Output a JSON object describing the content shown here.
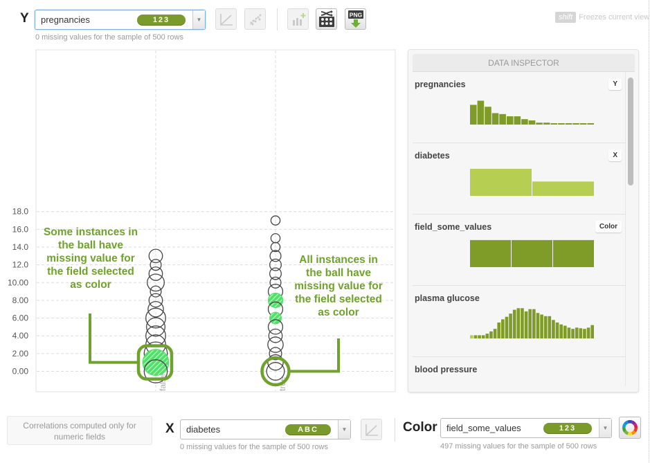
{
  "y_axis": {
    "letter": "Y",
    "field": "pregnancies",
    "type_badge": "123",
    "missing_note": "0 missing values for the sample of 500 rows"
  },
  "toolbar": {
    "buttons": [
      {
        "name": "regression-line-button",
        "icon": "line-chart-icon",
        "enabled": false
      },
      {
        "name": "scatter-trend-button",
        "icon": "scatter-icon",
        "enabled": false
      },
      {
        "name": "add-histogram-button",
        "icon": "bar-add-icon",
        "enabled": false
      },
      {
        "name": "shuffle-sample-button",
        "icon": "shuffle-grid-icon",
        "enabled": true
      },
      {
        "name": "export-png-button",
        "icon": "png-download-icon",
        "enabled": true,
        "label": "PNG"
      }
    ],
    "shift_key": "shift",
    "shift_hint": "Freezes current view"
  },
  "chart_data": {
    "type": "scatter",
    "title": "",
    "xlabel": "diabetes",
    "ylabel": "pregnancies",
    "ylim": [
      -1,
      18
    ],
    "y_ticks": [
      "18.0",
      "16.0",
      "14.0",
      "12.0",
      "10.00",
      "8.00",
      "6.00",
      "4.00",
      "2.00",
      "0.00"
    ],
    "y_tick_values": [
      18,
      16,
      14,
      12,
      10,
      8,
      6,
      4,
      2,
      0
    ],
    "categories": [
      "false",
      "true"
    ],
    "grid": true,
    "series": [
      {
        "name": "false",
        "points": [
          {
            "y": 13,
            "size": 2,
            "missing_color": "none"
          },
          {
            "y": 12,
            "size": 1,
            "missing_color": "none"
          },
          {
            "y": 11,
            "size": 2,
            "missing_color": "none"
          },
          {
            "y": 10,
            "size": 4,
            "missing_color": "none"
          },
          {
            "y": 9,
            "size": 1,
            "missing_color": "none"
          },
          {
            "y": 8,
            "size": 2,
            "missing_color": "none"
          },
          {
            "y": 7,
            "size": 3,
            "missing_color": "none"
          },
          {
            "y": 6,
            "size": 6,
            "missing_color": "none"
          },
          {
            "y": 5,
            "size": 5,
            "missing_color": "none"
          },
          {
            "y": 4,
            "size": 6,
            "missing_color": "none"
          },
          {
            "y": 3,
            "size": 6,
            "missing_color": "none"
          },
          {
            "y": 2,
            "size": 9,
            "missing_color": "none"
          },
          {
            "y": 1,
            "size": 12,
            "missing_color": "some"
          },
          {
            "y": 0,
            "size": 9,
            "missing_color": "none"
          }
        ]
      },
      {
        "name": "true",
        "points": [
          {
            "y": 17,
            "size": 0.5,
            "missing_color": "none"
          },
          {
            "y": 15,
            "size": 0.5,
            "missing_color": "none"
          },
          {
            "y": 14,
            "size": 0.5,
            "missing_color": "none"
          },
          {
            "y": 13,
            "size": 1,
            "missing_color": "none"
          },
          {
            "y": 12,
            "size": 1.2,
            "missing_color": "none"
          },
          {
            "y": 11,
            "size": 1.2,
            "missing_color": "none"
          },
          {
            "y": 10,
            "size": 1,
            "missing_color": "none"
          },
          {
            "y": 9,
            "size": 2.5,
            "missing_color": "none"
          },
          {
            "y": 8,
            "size": 2.5,
            "missing_color": "some"
          },
          {
            "y": 7,
            "size": 2.5,
            "missing_color": "none"
          },
          {
            "y": 6,
            "size": 1.2,
            "missing_color": "some"
          },
          {
            "y": 5,
            "size": 2.5,
            "missing_color": "none"
          },
          {
            "y": 4,
            "size": 2,
            "missing_color": "none"
          },
          {
            "y": 3,
            "size": 3,
            "missing_color": "none"
          },
          {
            "y": 2,
            "size": 1.5,
            "missing_color": "none"
          },
          {
            "y": 1,
            "size": 3,
            "missing_color": "none"
          },
          {
            "y": 0,
            "size": 4.5,
            "missing_color": "all"
          }
        ]
      }
    ],
    "annotations": [
      {
        "text": "Some instances in the ball have missing value for the field selected as color",
        "target": "false, y=1"
      },
      {
        "text": "All instances in the ball have missing value for the field selected as color",
        "target": "true, y=0"
      }
    ]
  },
  "annotations": {
    "left": "Some instances in the ball have missing value for the field selected as color",
    "right": "All instances in the ball have missing value for the field selected as color"
  },
  "inspector": {
    "title": "DATA INSPECTOR",
    "fields": [
      {
        "name": "pregnancies",
        "tag": "Y",
        "bars": [
          0.62,
          0.75,
          0.56,
          0.36,
          0.33,
          0.26,
          0.26,
          0.17,
          0.13,
          0.06,
          0.06,
          0.03,
          0.03,
          0.03,
          0.03,
          0.03,
          0.03
        ],
        "color": "#7f9b28"
      },
      {
        "name": "diabetes",
        "tag": "X",
        "bars": [
          0.85,
          0.45
        ],
        "color": "#b6cf53"
      },
      {
        "name": "field_some_values",
        "tag": "Color",
        "bars": [
          0.85,
          0.85,
          0.85
        ],
        "color": "#7f9b28"
      },
      {
        "name": "plasma glucose",
        "tag": "",
        "bars": [
          0.1,
          0.1,
          0.1,
          0.1,
          0.15,
          0.22,
          0.3,
          0.5,
          0.6,
          0.68,
          0.78,
          0.9,
          0.95,
          0.95,
          0.85,
          0.92,
          0.92,
          0.8,
          0.75,
          0.7,
          0.7,
          0.58,
          0.5,
          0.44,
          0.4,
          0.34,
          0.3,
          0.34,
          0.32,
          0.3,
          0.34,
          0.42
        ],
        "color": "#7f9b28"
      },
      {
        "name": "blood pressure",
        "tag": "",
        "bars": [],
        "color": "#b6cf53"
      }
    ]
  },
  "x_axis": {
    "letter": "X",
    "field": "diabetes",
    "type_badge": "ABC",
    "missing_note": "0 missing values for the sample of 500 rows"
  },
  "correlation_note": "Correlations computed only for numeric fields",
  "color_axis": {
    "label": "Color",
    "field": "field_some_values",
    "type_badge": "123",
    "missing_note": "497 missing values for the sample of 500 rows"
  },
  "colors": {
    "accent": "#6fa22c",
    "missing_fill": "#52e06a",
    "hist_dark": "#7f9b28",
    "hist_light": "#b6cf53"
  }
}
